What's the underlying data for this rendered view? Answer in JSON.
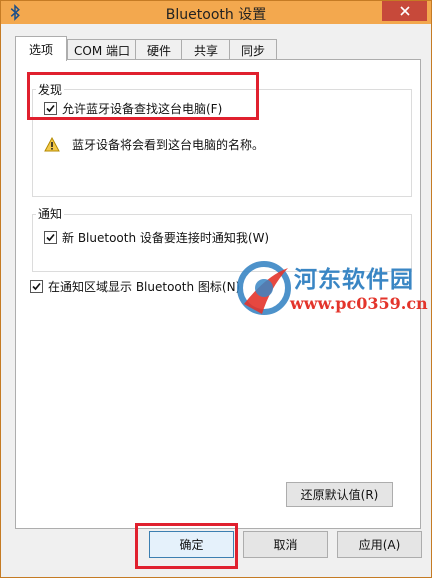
{
  "window": {
    "title": "Bluetooth 设置"
  },
  "tabs": [
    {
      "label": "选项",
      "active": true
    },
    {
      "label": "COM 端口",
      "active": false
    },
    {
      "label": "硬件",
      "active": false
    },
    {
      "label": "共享",
      "active": false
    },
    {
      "label": "同步",
      "active": false
    }
  ],
  "discovery": {
    "group_label": "发现",
    "allow_discovery_label": "允许蓝牙设备查找这台电脑(F)",
    "allow_discovery_checked": true,
    "warning_text": "蓝牙设备将会看到这台电脑的名称。"
  },
  "notifications": {
    "group_label": "通知",
    "notify_label": "新 Bluetooth 设备要连接时通知我(W)",
    "notify_checked": true
  },
  "show_tray_icon": {
    "label": "在通知区域显示 Bluetooth 图标(N)",
    "checked": true
  },
  "restore_defaults_label": "还原默认值(R)",
  "buttons": {
    "ok": "确定",
    "cancel": "取消",
    "apply": "应用(A)"
  },
  "watermark": {
    "site_name": "河东软件园",
    "url": "www.pc0359.cn"
  },
  "colors": {
    "titlebar": "#f3a84e",
    "close_button": "#c7493a",
    "highlight_box": "#e0202e",
    "watermark_blue": "#3a86c4",
    "watermark_red": "#e3342b"
  }
}
